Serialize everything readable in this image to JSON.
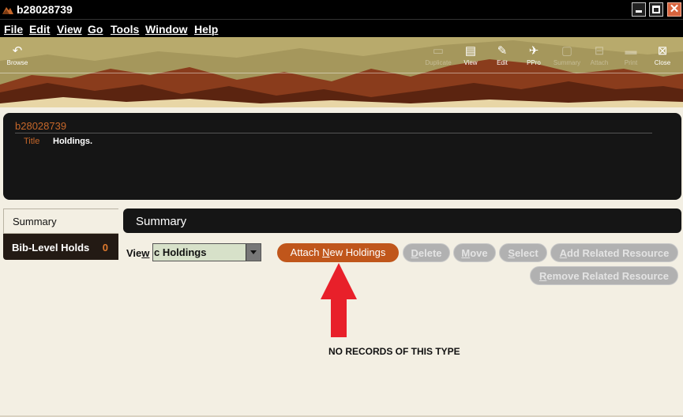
{
  "window": {
    "title": "b28028739"
  },
  "menu": {
    "items": [
      {
        "key": "F",
        "rest": "ile"
      },
      {
        "key": "E",
        "rest": "dit"
      },
      {
        "key": "V",
        "rest": "iew"
      },
      {
        "key": "G",
        "rest": "o"
      },
      {
        "key": "T",
        "rest": "ools"
      },
      {
        "key": "W",
        "rest": "indow"
      },
      {
        "key": "H",
        "rest": "elp"
      }
    ]
  },
  "toolbar": {
    "browse": "Browse",
    "dim1": "Duplicate",
    "view": "View",
    "edit": "Edit",
    "ppro": "PPro",
    "summary": "Summary",
    "dim2": "Attach",
    "dim3": "Print",
    "close": "Close"
  },
  "record": {
    "id": "b28028739",
    "title_label": "Title",
    "title_value": "Holdings."
  },
  "tabs": {
    "summary": "Summary",
    "holds_label": "Bib-Level Holds",
    "holds_count": "0"
  },
  "panel": {
    "header": "Summary"
  },
  "view": {
    "label_pre": "Vie",
    "label_key": "w",
    "selected": "c Holdings"
  },
  "buttons": {
    "attach_pre": "Attach ",
    "attach_key": "N",
    "attach_post": "ew Holdings",
    "delete_key": "D",
    "delete_post": "elete",
    "move_key": "M",
    "move_post": "ove",
    "select_key": "S",
    "select_post": "elect",
    "add_key": "A",
    "add_post": "dd Related Resource",
    "remove_key": "R",
    "remove_post": "emove Related Resource"
  },
  "message": "NO RECORDS OF THIS TYPE",
  "colors": {
    "accent": "#c0561b",
    "annotation_arrow": "#e8202a"
  }
}
